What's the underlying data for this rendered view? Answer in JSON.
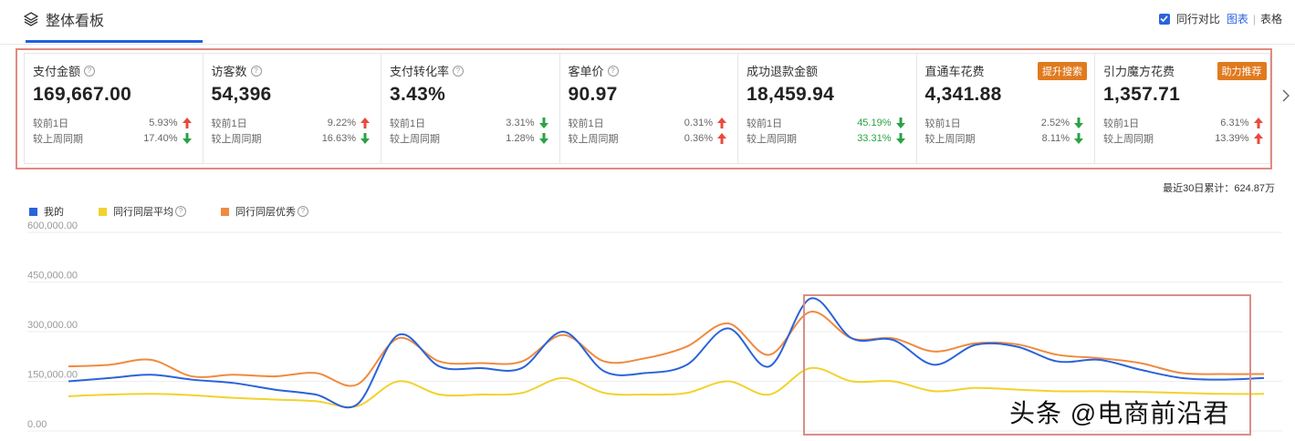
{
  "header": {
    "title": "整体看板",
    "compare_label": "同行对比",
    "view_chart": "图表",
    "separator": "|",
    "view_table": "表格"
  },
  "metrics": [
    {
      "label": "支付金额",
      "help": true,
      "value": "169,667.00",
      "badge": "",
      "rows": [
        {
          "name": "较前1日",
          "pct": "5.93%",
          "dir": "up",
          "color": "grey"
        },
        {
          "name": "较上周同期",
          "pct": "17.40%",
          "dir": "down",
          "color": "grey"
        }
      ]
    },
    {
      "label": "访客数",
      "help": true,
      "value": "54,396",
      "badge": "",
      "rows": [
        {
          "name": "较前1日",
          "pct": "9.22%",
          "dir": "up",
          "color": "grey"
        },
        {
          "name": "较上周同期",
          "pct": "16.63%",
          "dir": "down",
          "color": "grey"
        }
      ]
    },
    {
      "label": "支付转化率",
      "help": true,
      "value": "3.43%",
      "badge": "",
      "rows": [
        {
          "name": "较前1日",
          "pct": "3.31%",
          "dir": "down",
          "color": "grey"
        },
        {
          "name": "较上周同期",
          "pct": "1.28%",
          "dir": "down",
          "color": "grey"
        }
      ]
    },
    {
      "label": "客单价",
      "help": true,
      "value": "90.97",
      "badge": "",
      "rows": [
        {
          "name": "较前1日",
          "pct": "0.31%",
          "dir": "up",
          "color": "grey"
        },
        {
          "name": "较上周同期",
          "pct": "0.36%",
          "dir": "up",
          "color": "grey"
        }
      ]
    },
    {
      "label": "成功退款金额",
      "help": false,
      "value": "18,459.94",
      "badge": "",
      "rows": [
        {
          "name": "较前1日",
          "pct": "45.19%",
          "dir": "down",
          "color": "green"
        },
        {
          "name": "较上周同期",
          "pct": "33.31%",
          "dir": "down",
          "color": "green"
        }
      ]
    },
    {
      "label": "直通车花费",
      "help": false,
      "value": "4,341.88",
      "badge": "提升搜索",
      "rows": [
        {
          "name": "较前1日",
          "pct": "2.52%",
          "dir": "down",
          "color": "grey"
        },
        {
          "name": "较上周同期",
          "pct": "8.11%",
          "dir": "down",
          "color": "grey"
        }
      ]
    },
    {
      "label": "引力魔方花费",
      "help": false,
      "value": "1,357.71",
      "badge": "助力推荐",
      "rows": [
        {
          "name": "较前1日",
          "pct": "6.31%",
          "dir": "up",
          "color": "grey"
        },
        {
          "name": "较上周同期",
          "pct": "13.39%",
          "dir": "up",
          "color": "grey"
        }
      ]
    }
  ],
  "cumulative": "最近30日累计：624.87万",
  "colors": {
    "up": "#e84a3c",
    "down": "#2ba245",
    "mine": "#2a63db",
    "avg": "#f2d22e",
    "top": "#f08a3e",
    "accent": "#2a63db",
    "badge": "#e07a1f"
  },
  "icons": [
    "layers-icon",
    "checkbox-checked-icon",
    "help-circle-icon",
    "arrow-up-icon",
    "arrow-down-icon",
    "chevron-right-icon"
  ],
  "chart_data": {
    "type": "line",
    "x": [
      1,
      2,
      3,
      4,
      5,
      6,
      7,
      8,
      9,
      10,
      11,
      12,
      13,
      14,
      15,
      16,
      17,
      18,
      19,
      20,
      21,
      22,
      23,
      24,
      25,
      26,
      27,
      28,
      29,
      30
    ],
    "ylim": [
      0,
      600000
    ],
    "yticks": [
      "600,000.00",
      "450,000.00",
      "300,000.00",
      "150,000.00",
      "0.00"
    ],
    "legend_position": "top-left",
    "grid": true,
    "series": [
      {
        "name": "我的",
        "help": false,
        "values": [
          150000,
          160000,
          170000,
          155000,
          145000,
          125000,
          110000,
          80000,
          290000,
          195000,
          190000,
          190000,
          300000,
          180000,
          175000,
          200000,
          310000,
          195000,
          400000,
          280000,
          275000,
          200000,
          260000,
          255000,
          210000,
          215000,
          185000,
          160000,
          155000,
          160000
        ]
      },
      {
        "name": "同行同层平均",
        "help": true,
        "values": [
          105000,
          110000,
          112000,
          108000,
          100000,
          95000,
          90000,
          75000,
          150000,
          110000,
          110000,
          115000,
          160000,
          115000,
          110000,
          115000,
          150000,
          110000,
          190000,
          150000,
          150000,
          120000,
          130000,
          125000,
          120000,
          120000,
          118000,
          115000,
          112000,
          112000
        ]
      },
      {
        "name": "同行同层优秀",
        "help": true,
        "values": [
          195000,
          200000,
          215000,
          165000,
          170000,
          165000,
          175000,
          140000,
          280000,
          210000,
          205000,
          210000,
          290000,
          210000,
          220000,
          255000,
          325000,
          230000,
          360000,
          280000,
          280000,
          240000,
          265000,
          262000,
          230000,
          220000,
          205000,
          175000,
          172000,
          172000
        ]
      }
    ]
  },
  "watermark": "头条 @电商前沿君"
}
